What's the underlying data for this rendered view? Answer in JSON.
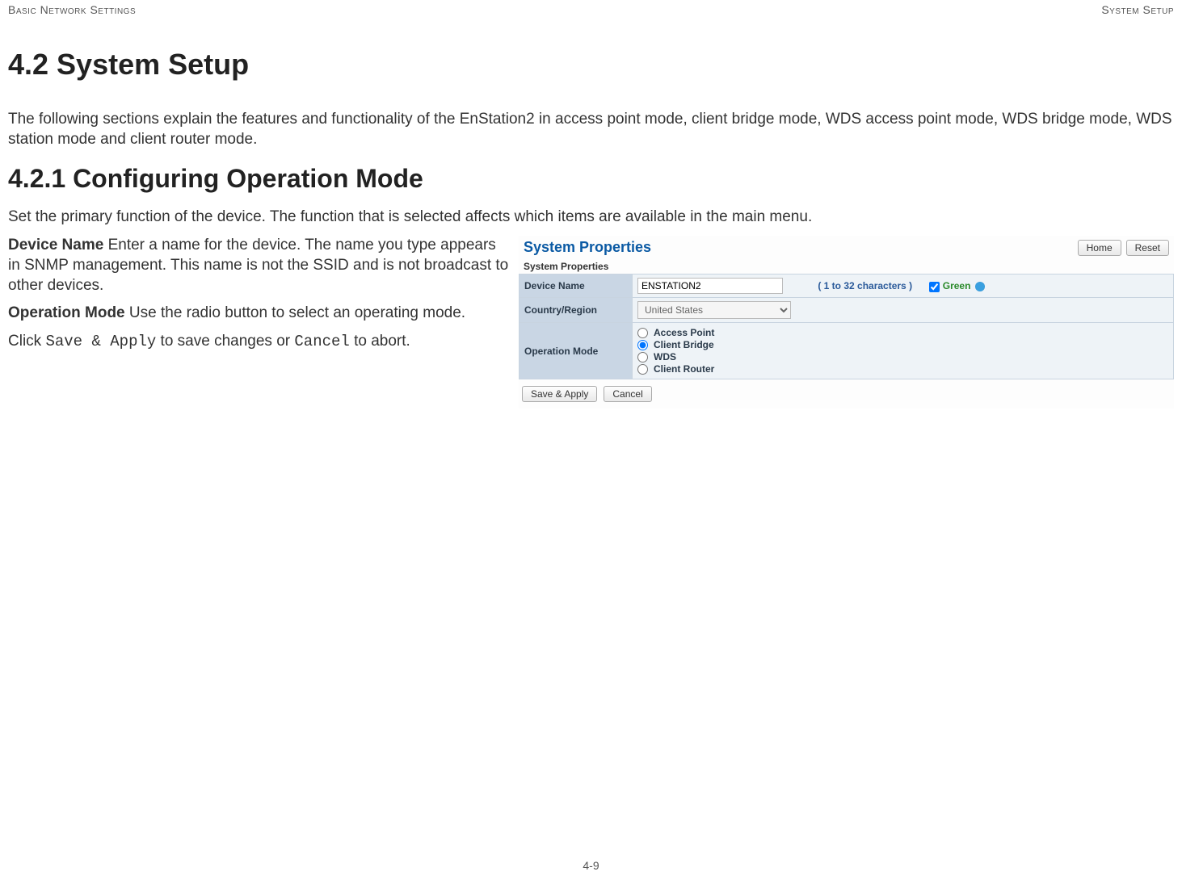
{
  "header": {
    "left": "Basic Network Settings",
    "right": "System Setup"
  },
  "headings": {
    "main": "4.2 System Setup",
    "sub": "4.2.1 Configuring Operation Mode"
  },
  "intro": "The following sections explain the features and functionality of the EnStation2 in access point mode, client bridge mode, WDS access point mode, WDS bridge mode, WDS station mode and client router mode.",
  "sub_intro": "Set the primary function of the device. The function that is selected affects which items are available in the main menu.",
  "body": {
    "device_name_label": "Device Name",
    "device_name_text": "  Enter a name for the device. The name you type appears in SNMP management. This name is not the SSID and is not broadcast to other devices.",
    "operation_mode_label": "Operation Mode",
    "operation_mode_text": "  Use the radio button to select an operating mode.",
    "action_prefix": "Click ",
    "save_apply": "Save & Apply",
    "action_mid": " to save changes or ",
    "cancel": "Cancel",
    "action_suffix": " to abort."
  },
  "panel": {
    "title": "System Properties",
    "home_btn": "Home",
    "reset_btn": "Reset",
    "section_title": "System Properties",
    "rows": {
      "device_name_label": "Device Name",
      "device_name_value": "ENSTATION2",
      "chars_note": "( 1 to 32 characters )",
      "green_link": "Green",
      "country_label": "Country/Region",
      "country_value": "United States",
      "op_mode_label": "Operation Mode",
      "op_options": {
        "ap": "Access Point",
        "cb": "Client Bridge",
        "wds": "WDS",
        "cr": "Client Router"
      }
    },
    "save_apply_btn": "Save & Apply",
    "cancel_btn": "Cancel"
  },
  "page_number": "4-9"
}
